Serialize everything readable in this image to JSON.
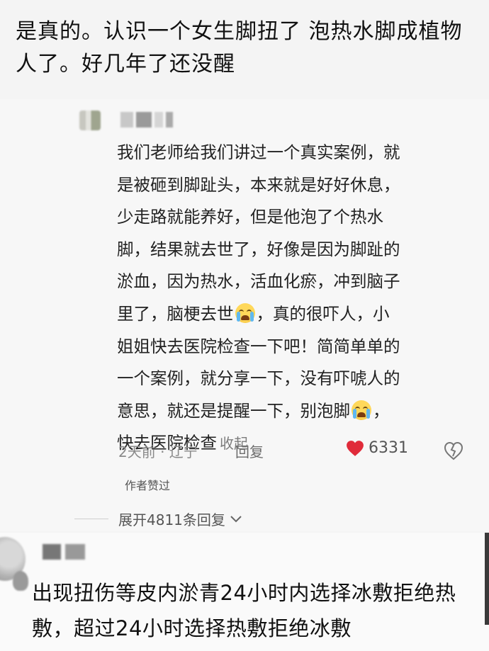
{
  "top_comment": {
    "text": "是真的。认识一个女生脚扭了 泡热水脚成植物人了。好几年了还没醒"
  },
  "reply": {
    "lines": [
      "我们老师给我们讲过一个真实案例，就",
      "是被砸到脚趾头，本来就是好好休息，",
      "少走路就能养好，但是他泡了个热水",
      "脚，结果就去世了，好像是因为脚趾的",
      "淤血，因为热水，活血化瘀，冲到脑子"
    ],
    "line6_before": "里了，脑梗去世",
    "line6_after": "，真的很吓人，小",
    "line7": "姐姐快去医院检查一下吧！简简单单的",
    "line8": "一个案例，就分享一下，没有吓唬人的",
    "line9_before": "意思，就还是提醒一下，别泡脚",
    "line9_after": "，",
    "line10": "快去医院检查",
    "collapse_label": "收起",
    "emoji_icon": "crying-face-icon",
    "time_location": "2天前 · 辽宁",
    "reply_label": "回复",
    "like_count": "6331",
    "like_color": "#e02b3a",
    "author_liked": "作者赞过",
    "expand_label": "展开4811条回复"
  },
  "second_comment": {
    "text": "出现扭伤等皮内淤青24小时内选择冰敷拒绝热敷，超过24小时选择热敷拒绝冰敷"
  }
}
